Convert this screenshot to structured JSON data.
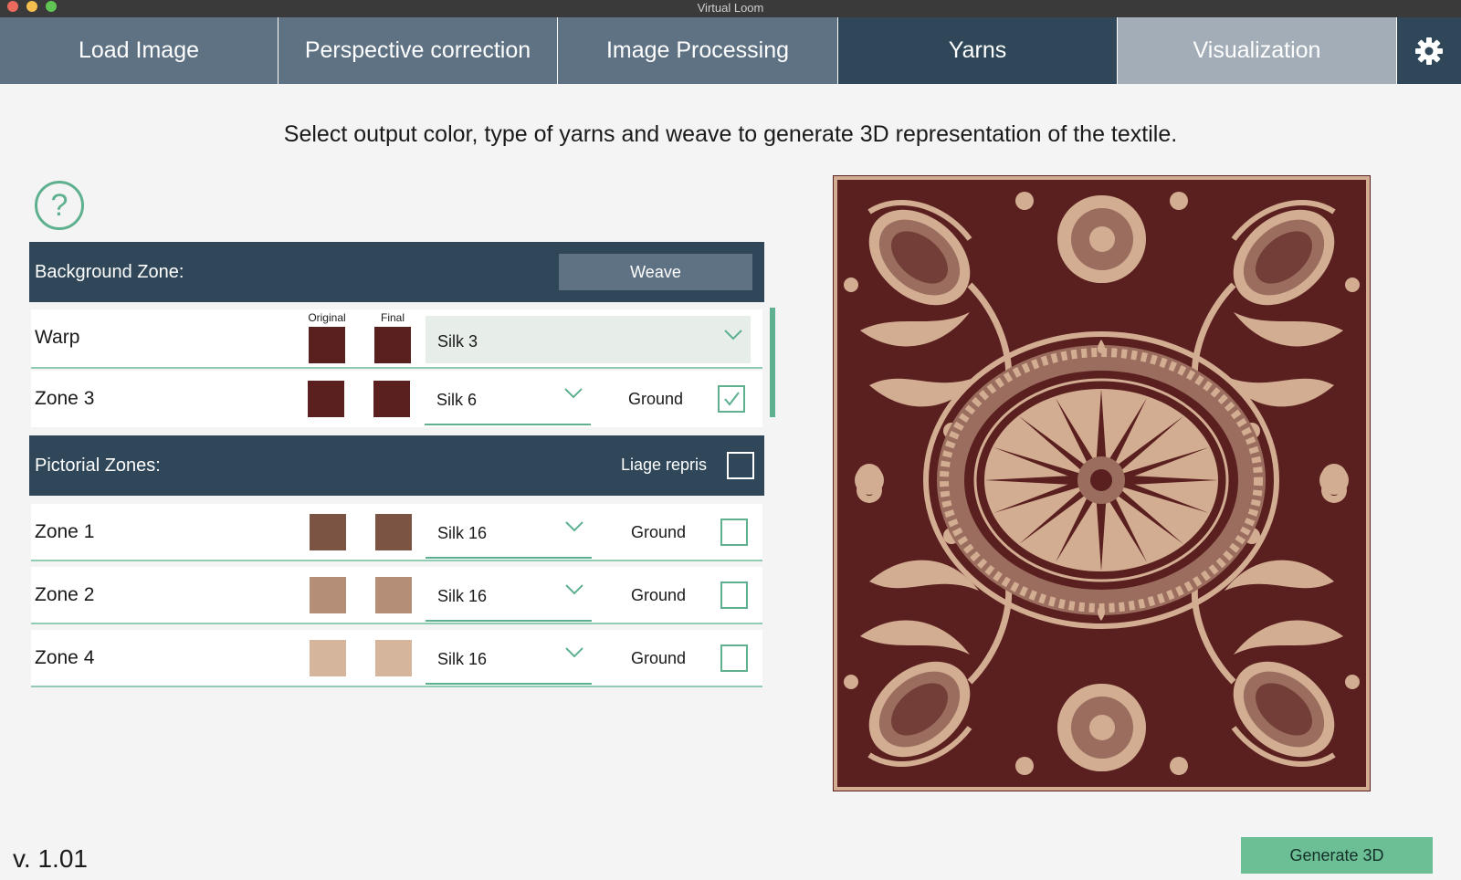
{
  "window": {
    "title": "Virtual Loom"
  },
  "tabs": [
    {
      "label": "Load Image"
    },
    {
      "label": "Perspective correction"
    },
    {
      "label": "Image Processing"
    },
    {
      "label": "Yarns"
    },
    {
      "label": "Visualization"
    }
  ],
  "settings_icon": "gear-icon",
  "instruction": "Select output color, type of yarns and weave to generate 3D representation of the textile.",
  "help_icon": "question-mark-icon",
  "help_glyph": "?",
  "background_zone": {
    "title": "Background Zone:",
    "weave_label": "Weave",
    "column_original": "Original",
    "column_final": "Final",
    "rows": [
      {
        "label": "Warp",
        "original_color": "#5a1f1f",
        "final_color": "#5a1f1f",
        "yarn": "Silk 3"
      },
      {
        "label": "Zone 3",
        "original_color": "#5a1f1f",
        "final_color": "#5a1f1f",
        "yarn": "Silk 6",
        "ground_label": "Ground",
        "ground_checked": true
      }
    ]
  },
  "pictorial_zones": {
    "title": "Pictorial Zones:",
    "liage_label": "Liage repris",
    "liage_checked": false,
    "rows": [
      {
        "label": "Zone 1",
        "original_color": "#7b5444",
        "final_color": "#7b5444",
        "yarn": "Silk 16",
        "ground_label": "Ground",
        "ground_checked": false
      },
      {
        "label": "Zone 2",
        "original_color": "#b48e76",
        "final_color": "#b48e76",
        "yarn": "Silk 16",
        "ground_label": "Ground",
        "ground_checked": false
      },
      {
        "label": "Zone 4",
        "original_color": "#d5b69d",
        "final_color": "#d5b69d",
        "yarn": "Silk 16",
        "ground_label": "Ground",
        "ground_checked": false
      }
    ]
  },
  "preview": {
    "ground_color": "#5a1f1f",
    "motif_color": "#d2ad92",
    "mid_color": "#9a6d5e"
  },
  "version": "v. 1.01",
  "generate_label": "Generate 3D",
  "accent_color": "#5eb08f",
  "header_color": "#2f4758"
}
